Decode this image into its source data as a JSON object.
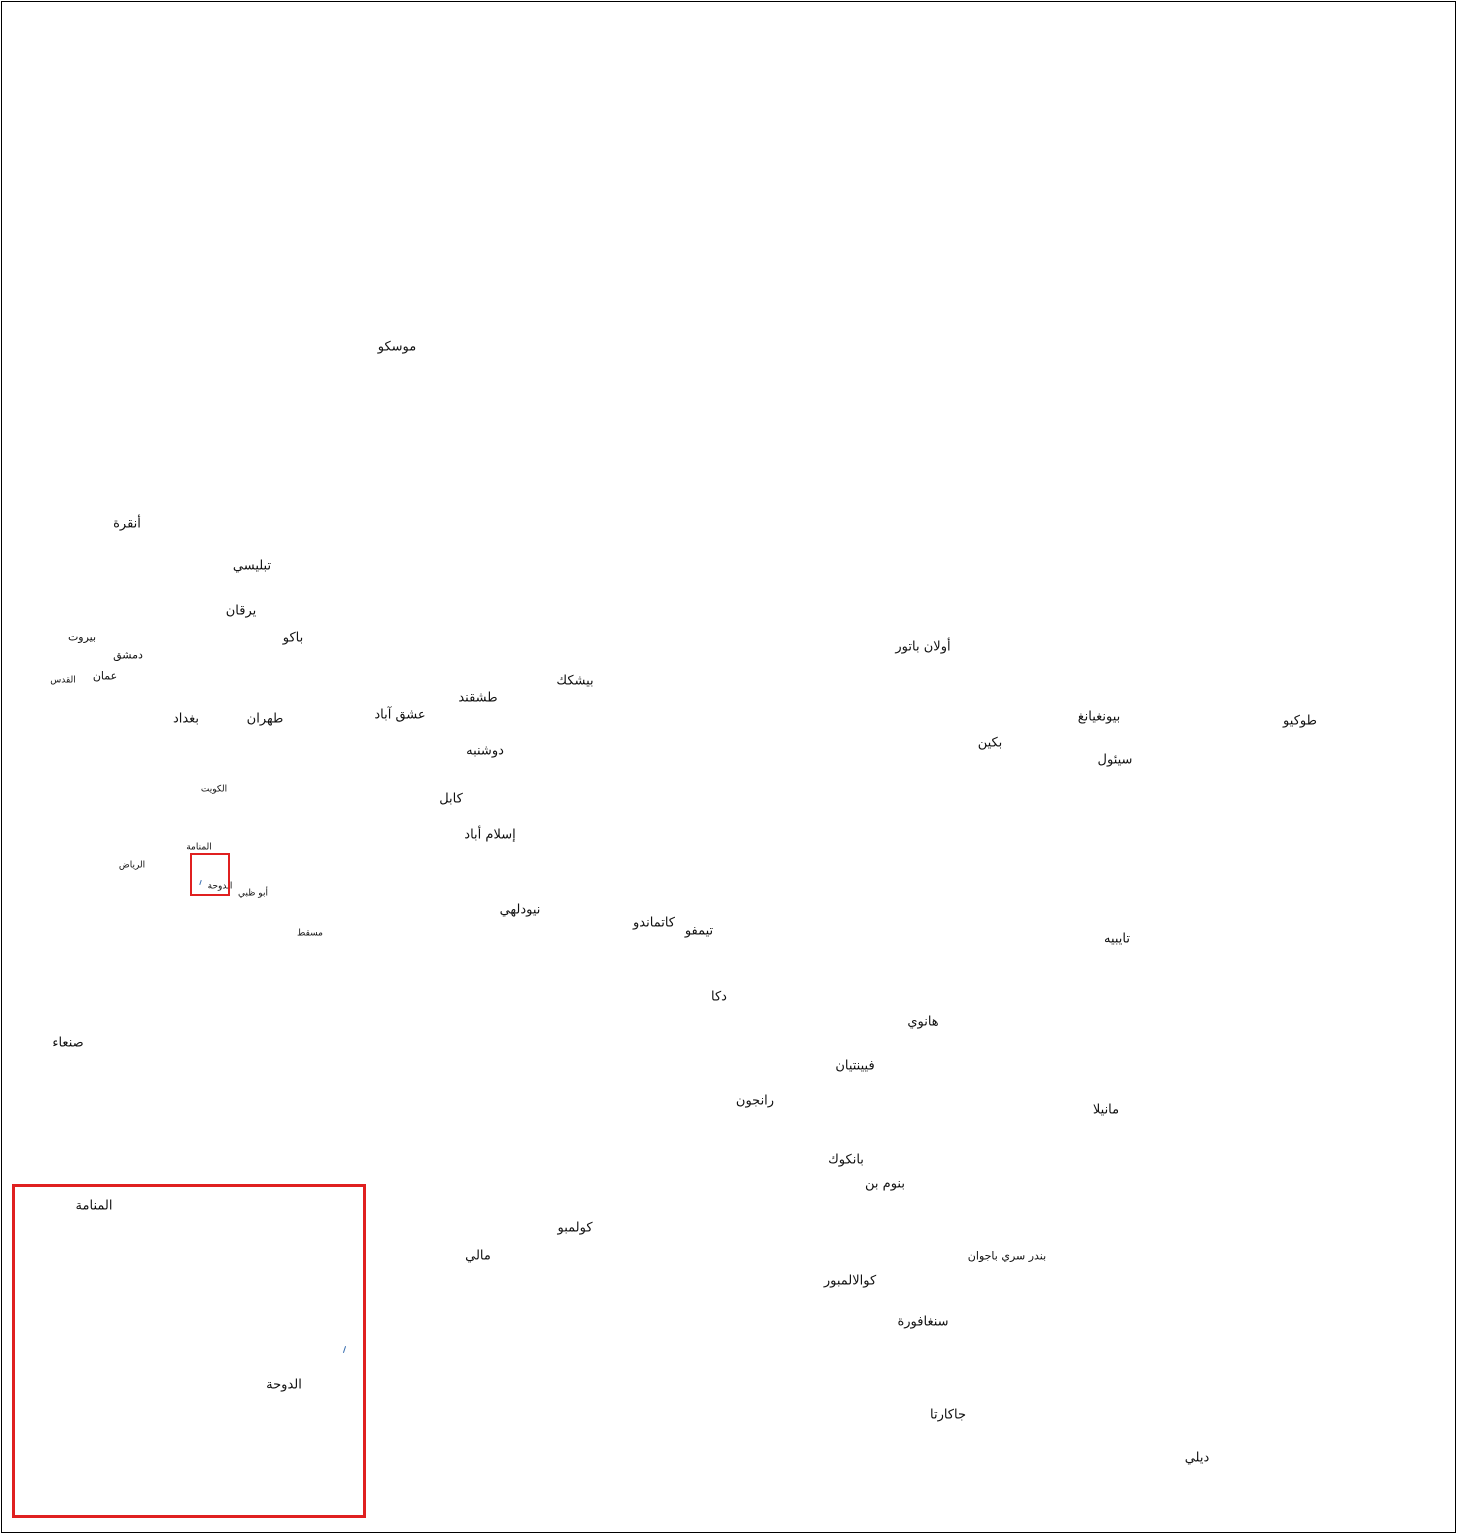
{
  "map": {
    "cities": [
      {
        "id": "moscow",
        "name": "موسكو"
      },
      {
        "id": "ankara",
        "name": "أنقرة"
      },
      {
        "id": "tbilisi",
        "name": "تبليسي"
      },
      {
        "id": "yerevan",
        "name": "يرقان"
      },
      {
        "id": "beirut",
        "name": "بيروت"
      },
      {
        "id": "baku",
        "name": "باكو"
      },
      {
        "id": "damascus",
        "name": "دمشق"
      },
      {
        "id": "amman",
        "name": "عمان"
      },
      {
        "id": "jerusalem",
        "name": "القدس"
      },
      {
        "id": "baghdad",
        "name": "بغداد"
      },
      {
        "id": "tehran",
        "name": "طهران"
      },
      {
        "id": "ashgabat",
        "name": "عشق آباد"
      },
      {
        "id": "tashkent",
        "name": "طشقند"
      },
      {
        "id": "bishkek",
        "name": "بيشكك"
      },
      {
        "id": "dushanbe",
        "name": "دوشنبه"
      },
      {
        "id": "kabul",
        "name": "كابل"
      },
      {
        "id": "kuwait",
        "name": "الكويت"
      },
      {
        "id": "islamabad",
        "name": "إسلام أباد"
      },
      {
        "id": "manama",
        "name": "المنامة"
      },
      {
        "id": "riyadh",
        "name": "الرياض"
      },
      {
        "id": "doha",
        "name": "الدوحة"
      },
      {
        "id": "abu-dhabi",
        "name": "أبو ظبي"
      },
      {
        "id": "muscat",
        "name": "مسقط"
      },
      {
        "id": "new-delhi",
        "name": "نيودلهي"
      },
      {
        "id": "kathmandu",
        "name": "كاتماندو"
      },
      {
        "id": "thimphu",
        "name": "تيمفو"
      },
      {
        "id": "ulaanbaatar",
        "name": "أولان باتور"
      },
      {
        "id": "beijing",
        "name": "بكين"
      },
      {
        "id": "pyongyang",
        "name": "بيونغيانغ"
      },
      {
        "id": "seoul",
        "name": "سيئول"
      },
      {
        "id": "tokyo",
        "name": "طوكيو"
      },
      {
        "id": "taipei",
        "name": "تايبيه"
      },
      {
        "id": "dhaka",
        "name": "دكا"
      },
      {
        "id": "hanoi",
        "name": "هانوي"
      },
      {
        "id": "sanaa",
        "name": "صنعاء"
      },
      {
        "id": "vientiane",
        "name": "فيينتيان"
      },
      {
        "id": "yangon",
        "name": "رانجون"
      },
      {
        "id": "manila",
        "name": "مانيلا"
      },
      {
        "id": "bangkok",
        "name": "بانكوك"
      },
      {
        "id": "phnom-penh",
        "name": "بنوم بن"
      },
      {
        "id": "colombo",
        "name": "كولمبو"
      },
      {
        "id": "male",
        "name": "مالي"
      },
      {
        "id": "bandar-seri-begawan",
        "name": "بندر سري باجوان"
      },
      {
        "id": "kuala-lumpur",
        "name": "كوالالمبور"
      },
      {
        "id": "singapore",
        "name": "سنغافورة"
      },
      {
        "id": "jakarta",
        "name": "جاكارتا"
      },
      {
        "id": "dili",
        "name": "ديلي"
      }
    ],
    "inset": {
      "labels": [
        {
          "id": "inset-manama",
          "name": "المنامة"
        },
        {
          "id": "inset-doha",
          "name": "الدوحة"
        }
      ]
    }
  }
}
